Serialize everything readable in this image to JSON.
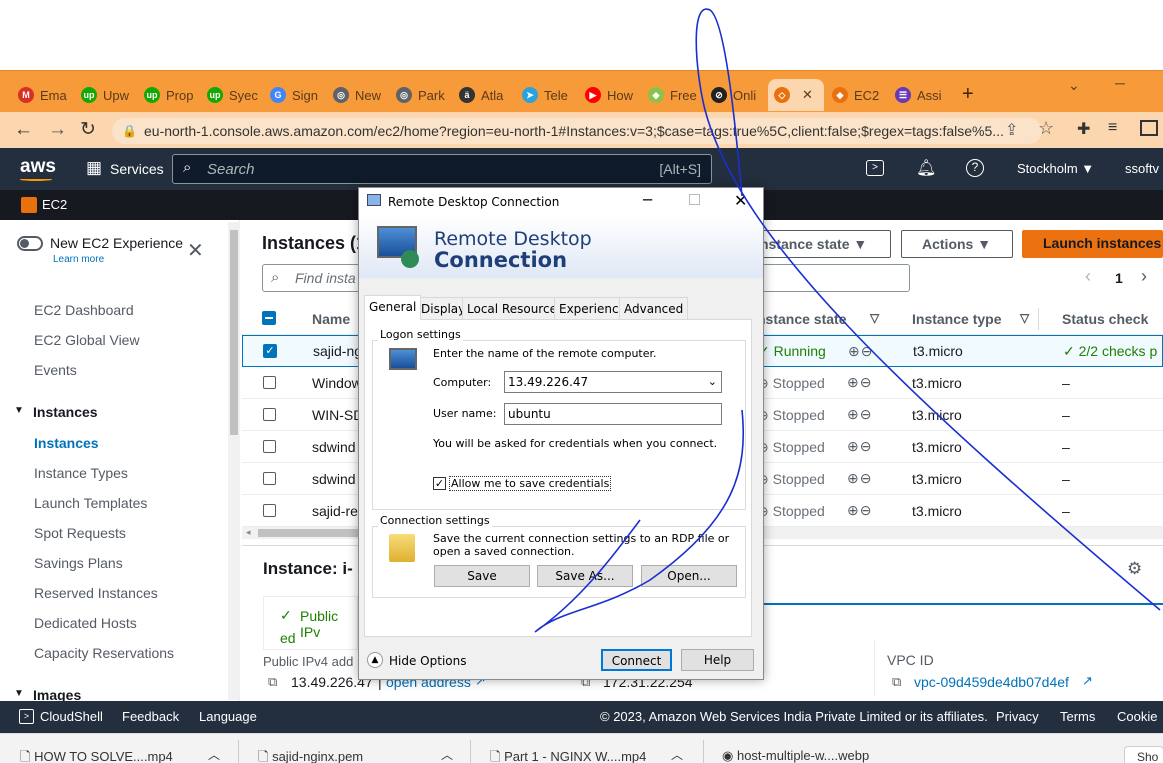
{
  "browser": {
    "tabs": [
      {
        "label": "Ema",
        "icon": "gmail-icon",
        "color": "#d93025",
        "glyph": "M"
      },
      {
        "label": "Upw",
        "icon": "upwork-icon",
        "color": "#14a800",
        "glyph": "up"
      },
      {
        "label": "Prop",
        "icon": "upwork-icon",
        "color": "#14a800",
        "glyph": "up"
      },
      {
        "label": "Syec",
        "icon": "upwork-icon",
        "color": "#14a800",
        "glyph": "up"
      },
      {
        "label": "Sign",
        "icon": "google-icon",
        "color": "#4285f4",
        "glyph": "G"
      },
      {
        "label": "New",
        "icon": "globe-icon",
        "color": "#5f6368",
        "glyph": "◎"
      },
      {
        "label": "Park",
        "icon": "globe-icon",
        "color": "#5f6368",
        "glyph": "◎"
      },
      {
        "label": "Atla",
        "icon": "atlassian-icon",
        "color": "#333",
        "glyph": "ä"
      },
      {
        "label": "Tele",
        "icon": "telegram-icon",
        "color": "#2aa2dc",
        "glyph": "➤"
      },
      {
        "label": "How",
        "icon": "youtube-icon",
        "color": "#ff0000",
        "glyph": "▶"
      },
      {
        "label": "Free",
        "icon": "gem-icon",
        "color": "#8bc34a",
        "glyph": "◆"
      },
      {
        "label": "Onli",
        "icon": "online-icon",
        "color": "#222",
        "glyph": "⊘"
      },
      {
        "label": "",
        "icon": "aws-ec2-icon",
        "color": "#e8700d",
        "glyph": "◇"
      },
      {
        "label": "EC2",
        "icon": "aws-box-icon",
        "color": "#e8700d",
        "glyph": "◆"
      },
      {
        "label": "Assi",
        "icon": "list-icon",
        "color": "#673ab7",
        "glyph": "☰"
      }
    ],
    "url": "eu-north-1.console.aws.amazon.com/ec2/home?region=eu-north-1#Instances:v=3;$case=tags:true%5C,client:false;$regex=tags:false%5..."
  },
  "aws": {
    "logo": "aws",
    "services": "Services",
    "search_placeholder": "Search",
    "search_shortcut": "[Alt+S]",
    "region": "Stockholm ▼",
    "account": "ssoftv",
    "breadcrumb": "EC2"
  },
  "sidebar": {
    "new_experience": "New EC2 Experience",
    "learn_more": "Learn more",
    "items": [
      "EC2 Dashboard",
      "EC2 Global View",
      "Events"
    ],
    "instances_header": "Instances",
    "instances_items": [
      "Instances",
      "Instance Types",
      "Launch Templates",
      "Spot Requests",
      "Savings Plans",
      "Reserved Instances",
      "Dedicated Hosts",
      "Capacity Reservations"
    ],
    "images_header": "Images"
  },
  "main": {
    "title": "Instances (1",
    "find_placeholder": "Find insta",
    "instance_state_btn": "nstance state ▼",
    "actions_btn": "Actions ▼",
    "launch_btn": "Launch instances",
    "page_number": "1",
    "columns": {
      "name": "Name",
      "state": "nstance state",
      "type": "Instance type",
      "status": "Status check"
    },
    "rows": [
      {
        "name": "sajid-ng",
        "state": "Running",
        "type": "t3.micro",
        "status": "2/2 checks p",
        "checked": true
      },
      {
        "name": "Window",
        "state": "Stopped",
        "type": "t3.micro",
        "status": "–",
        "checked": false
      },
      {
        "name": "WIN-SD",
        "state": "Stopped",
        "type": "t3.micro",
        "status": "–",
        "checked": false
      },
      {
        "name": "sdwind",
        "state": "Stopped",
        "type": "t3.micro",
        "status": "–",
        "checked": false
      },
      {
        "name": "sdwind",
        "state": "Stopped",
        "type": "t3.micro",
        "status": "–",
        "checked": false
      },
      {
        "name": "sajid-re",
        "state": "Stopped",
        "type": "t3.micro",
        "status": "–",
        "checked": false
      }
    ],
    "detail_title": "Instance: i-",
    "public_ipv4_label": "Public IPv",
    "public_ipv4_suffix": "ed",
    "public_ipv4_addr_label": "Public IPv4 add",
    "public_ip": "13.49.226.47",
    "open_address": "open address",
    "private_ip": "172.31.22.254",
    "vpc_label": "VPC ID",
    "vpc_value": "vpc-09d459de4db07d4ef"
  },
  "footer": {
    "cloudshell": "CloudShell",
    "feedback": "Feedback",
    "language": "Language",
    "copyright": "© 2023, Amazon Web Services India Private Limited or its affiliates.",
    "privacy": "Privacy",
    "terms": "Terms",
    "cookie": "Cookie"
  },
  "taskbar": {
    "items": [
      "HOW TO SOLVE....mp4",
      "sajid-nginx.pem",
      "Part 1 - NGINX W....mp4",
      "host-multiple-w....webp"
    ],
    "show_all": "Sho"
  },
  "dialog": {
    "title": "Remote Desktop Connection",
    "banner_line1": "Remote Desktop",
    "banner_line2": "Connection",
    "tabs": [
      "General",
      "Display",
      "Local Resources",
      "Experience",
      "Advanced"
    ],
    "logon_settings": "Logon settings",
    "logon_prompt": "Enter the name of the remote computer.",
    "computer_label": "Computer:",
    "computer_value": "13.49.226.47",
    "username_label": "User name:",
    "username_value": "ubuntu",
    "credentials_note": "You will be asked for credentials when you connect.",
    "allow_save": "Allow me to save credentials",
    "connection_settings": "Connection settings",
    "connection_desc": "Save the current connection settings to an RDP file or open a saved connection.",
    "save": "Save",
    "save_as": "Save As...",
    "open": "Open...",
    "hide_options": "Hide Options",
    "connect": "Connect",
    "help": "Help"
  }
}
